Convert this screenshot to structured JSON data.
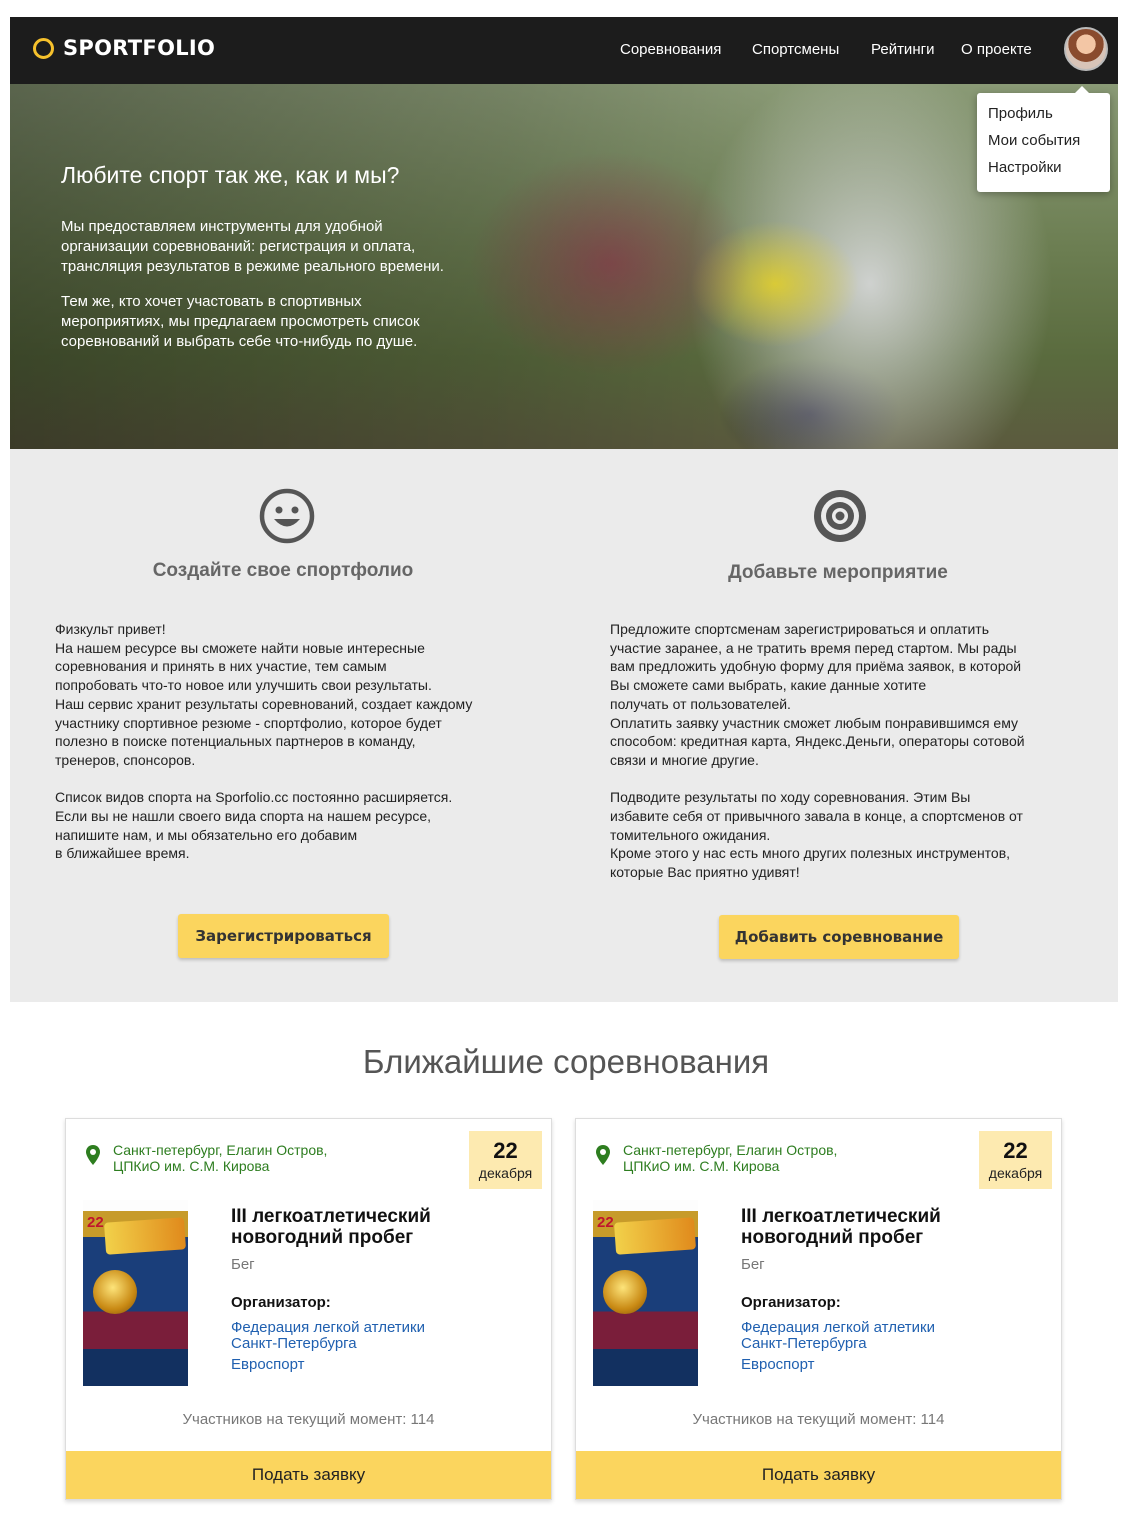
{
  "header": {
    "logo": "SPORTFOLIO",
    "nav": [
      "Соревнования",
      "Спортсмены",
      "Рейтинги",
      "О проекте"
    ],
    "dropdown": [
      "Профиль",
      "Мои события",
      "Настройки"
    ]
  },
  "hero": {
    "title": "Любите спорт так же, как и мы?",
    "p1": "Мы предоставляем инструменты для удобной\nорганизации соревнований: регистрация и оплата,\nтрансляция результатов в режиме реального времени.",
    "p2": "Тем же, кто хочет участовать в спортивных\nмероприятиях, мы предлагаем просмотреть список\nсоревнований и выбрать себе что-нибудь по душе."
  },
  "features": [
    {
      "icon": "smiley-icon",
      "title": "Создайте свое спортфолио",
      "text": "Физкульт привет!\nНа нашем ресурсе вы сможете найти новые интересные\nсоревнования и принять в них участие, тем самым\nпопробовать что-то новое или улучшить свои результаты.\nНаш сервис хранит результаты соревнований, создает каждому\nучастнику спортивное резюме - спортфолио, которое будет\nполезно в поиске потенциальных партнеров в команду,\nтренеров, спонсоров.\n\nСписок видов спорта на Sporfolio.cc постоянно расширяется.\nЕсли вы не нашли своего вида спорта на нашем ресурсе,\nнапишите нам, и мы обязательно его добавим\nв ближайшее время.",
      "button": "Зарегистрироваться"
    },
    {
      "icon": "target-icon",
      "title": "Добавьте мероприятие",
      "text": "Предложите спортсменам зарегистрироваться и оплатить\nучастие заранее, а не тратить время перед стартом. Мы рады\nвам предложить удобную форму для приёма заявок, в которой\nВы сможете сами выбрать, какие данные хотите\nполучать от пользователей.\nОплатить заявку участник сможет любым понравившимся ему\nспособом: кредитная карта, Яндекс.Деньги, операторы сотовой\nсвязи и многие другие.\n\nПодводите результаты по ходу соревнования. Этим Вы\nизбавите себя от привычного завала в конце, а спортсменов от\nтомительного ожидания.\nКроме этого у нас есть много других полезных инструментов,\nкоторые Вас приятно удивят!",
      "button": "Добавить соревнование"
    }
  ],
  "upcoming": {
    "title": "Ближайшие соревнования",
    "cards": [
      {
        "location": "Санкт-петербург, Елагин Остров,\nЦПКиО им. С.М. Кирова",
        "day": "22",
        "month": "декабря",
        "poster_day": "22",
        "title": "III легкоатлетический новогодний пробег",
        "sport": "Бег",
        "org_label": "Организатор:",
        "org1": "Федерация легкой атлетики\nСанкт-Петербурга",
        "org2": "Евроспорт",
        "participants": "Участников на текущий момент: 114",
        "button": "Подать заявку"
      },
      {
        "location": "Санкт-петербург, Елагин Остров,\nЦПКиО им. С.М. Кирова",
        "day": "22",
        "month": "декабря",
        "poster_day": "22",
        "title": "III легкоатлетический новогодний пробег",
        "sport": "Бег",
        "org_label": "Организатор:",
        "org1": "Федерация легкой атлетики\nСанкт-Петербурга",
        "org2": "Евроспорт",
        "participants": "Участников на текущий момент: 114",
        "button": "Подать заявку"
      }
    ]
  },
  "colors": {
    "header_bg": "#1c1c1c",
    "accent_yellow": "#fbd55e",
    "logo_ring": "#f6c12c",
    "location_green": "#2d7d1f",
    "link_blue": "#2060b0",
    "features_bg": "#ebebeb"
  }
}
